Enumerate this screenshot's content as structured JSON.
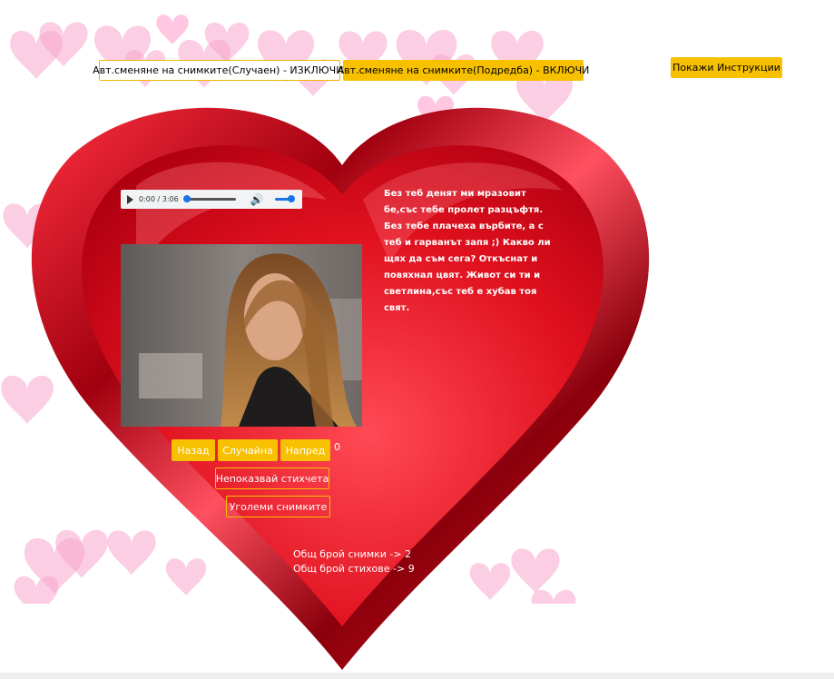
{
  "top_buttons": {
    "random_toggle": "Авт.сменяне на снимките(Случаен) - ИЗКЛЮЧИ.",
    "ordered_toggle": "Авт.сменяне на снимките(Подредба) - ВКЛЮЧИ",
    "instructions": "Покажи Инструкции"
  },
  "audio": {
    "time": "0:00 / 3:06",
    "icons": [
      "play-icon",
      "volume-icon"
    ],
    "progress": 0,
    "volume": 1
  },
  "poem": "Без теб денят ми мразовит бе,със тебе пролет разцъфтя. Без тебе плачеха върбите, а с теб и гарванът запя ;) Какво ли щях да съм сега? Откъснат и повяхнал цвят. Живот си ти и светлина,със теб е хубав тоя свят.",
  "controls": {
    "back": "Назад",
    "random": "Случайна",
    "next": "Напред",
    "index": "0",
    "hide_poems": "Непоказвай стихчета",
    "enlarge": "Уголеми снимките"
  },
  "totals": {
    "photos": "Общ брой снимки -> 2",
    "poems": "Общ брой стихове -> 9"
  },
  "colors": {
    "accent": "#f7c000",
    "heart": "#d8001a",
    "heart_dark": "#7a0010",
    "pink": "#f9a8cf"
  }
}
